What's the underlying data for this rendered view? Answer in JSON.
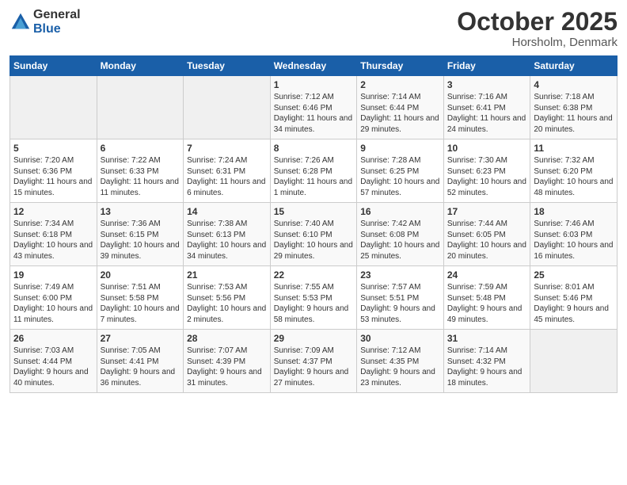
{
  "logo": {
    "general": "General",
    "blue": "Blue"
  },
  "header": {
    "month": "October 2025",
    "location": "Horsholm, Denmark"
  },
  "weekdays": [
    "Sunday",
    "Monday",
    "Tuesday",
    "Wednesday",
    "Thursday",
    "Friday",
    "Saturday"
  ],
  "weeks": [
    [
      {
        "day": "",
        "info": ""
      },
      {
        "day": "",
        "info": ""
      },
      {
        "day": "",
        "info": ""
      },
      {
        "day": "1",
        "info": "Sunrise: 7:12 AM\nSunset: 6:46 PM\nDaylight: 11 hours and 34 minutes."
      },
      {
        "day": "2",
        "info": "Sunrise: 7:14 AM\nSunset: 6:44 PM\nDaylight: 11 hours and 29 minutes."
      },
      {
        "day": "3",
        "info": "Sunrise: 7:16 AM\nSunset: 6:41 PM\nDaylight: 11 hours and 24 minutes."
      },
      {
        "day": "4",
        "info": "Sunrise: 7:18 AM\nSunset: 6:38 PM\nDaylight: 11 hours and 20 minutes."
      }
    ],
    [
      {
        "day": "5",
        "info": "Sunrise: 7:20 AM\nSunset: 6:36 PM\nDaylight: 11 hours and 15 minutes."
      },
      {
        "day": "6",
        "info": "Sunrise: 7:22 AM\nSunset: 6:33 PM\nDaylight: 11 hours and 11 minutes."
      },
      {
        "day": "7",
        "info": "Sunrise: 7:24 AM\nSunset: 6:31 PM\nDaylight: 11 hours and 6 minutes."
      },
      {
        "day": "8",
        "info": "Sunrise: 7:26 AM\nSunset: 6:28 PM\nDaylight: 11 hours and 1 minute."
      },
      {
        "day": "9",
        "info": "Sunrise: 7:28 AM\nSunset: 6:25 PM\nDaylight: 10 hours and 57 minutes."
      },
      {
        "day": "10",
        "info": "Sunrise: 7:30 AM\nSunset: 6:23 PM\nDaylight: 10 hours and 52 minutes."
      },
      {
        "day": "11",
        "info": "Sunrise: 7:32 AM\nSunset: 6:20 PM\nDaylight: 10 hours and 48 minutes."
      }
    ],
    [
      {
        "day": "12",
        "info": "Sunrise: 7:34 AM\nSunset: 6:18 PM\nDaylight: 10 hours and 43 minutes."
      },
      {
        "day": "13",
        "info": "Sunrise: 7:36 AM\nSunset: 6:15 PM\nDaylight: 10 hours and 39 minutes."
      },
      {
        "day": "14",
        "info": "Sunrise: 7:38 AM\nSunset: 6:13 PM\nDaylight: 10 hours and 34 minutes."
      },
      {
        "day": "15",
        "info": "Sunrise: 7:40 AM\nSunset: 6:10 PM\nDaylight: 10 hours and 29 minutes."
      },
      {
        "day": "16",
        "info": "Sunrise: 7:42 AM\nSunset: 6:08 PM\nDaylight: 10 hours and 25 minutes."
      },
      {
        "day": "17",
        "info": "Sunrise: 7:44 AM\nSunset: 6:05 PM\nDaylight: 10 hours and 20 minutes."
      },
      {
        "day": "18",
        "info": "Sunrise: 7:46 AM\nSunset: 6:03 PM\nDaylight: 10 hours and 16 minutes."
      }
    ],
    [
      {
        "day": "19",
        "info": "Sunrise: 7:49 AM\nSunset: 6:00 PM\nDaylight: 10 hours and 11 minutes."
      },
      {
        "day": "20",
        "info": "Sunrise: 7:51 AM\nSunset: 5:58 PM\nDaylight: 10 hours and 7 minutes."
      },
      {
        "day": "21",
        "info": "Sunrise: 7:53 AM\nSunset: 5:56 PM\nDaylight: 10 hours and 2 minutes."
      },
      {
        "day": "22",
        "info": "Sunrise: 7:55 AM\nSunset: 5:53 PM\nDaylight: 9 hours and 58 minutes."
      },
      {
        "day": "23",
        "info": "Sunrise: 7:57 AM\nSunset: 5:51 PM\nDaylight: 9 hours and 53 minutes."
      },
      {
        "day": "24",
        "info": "Sunrise: 7:59 AM\nSunset: 5:48 PM\nDaylight: 9 hours and 49 minutes."
      },
      {
        "day": "25",
        "info": "Sunrise: 8:01 AM\nSunset: 5:46 PM\nDaylight: 9 hours and 45 minutes."
      }
    ],
    [
      {
        "day": "26",
        "info": "Sunrise: 7:03 AM\nSunset: 4:44 PM\nDaylight: 9 hours and 40 minutes."
      },
      {
        "day": "27",
        "info": "Sunrise: 7:05 AM\nSunset: 4:41 PM\nDaylight: 9 hours and 36 minutes."
      },
      {
        "day": "28",
        "info": "Sunrise: 7:07 AM\nSunset: 4:39 PM\nDaylight: 9 hours and 31 minutes."
      },
      {
        "day": "29",
        "info": "Sunrise: 7:09 AM\nSunset: 4:37 PM\nDaylight: 9 hours and 27 minutes."
      },
      {
        "day": "30",
        "info": "Sunrise: 7:12 AM\nSunset: 4:35 PM\nDaylight: 9 hours and 23 minutes."
      },
      {
        "day": "31",
        "info": "Sunrise: 7:14 AM\nSunset: 4:32 PM\nDaylight: 9 hours and 18 minutes."
      },
      {
        "day": "",
        "info": ""
      }
    ]
  ]
}
